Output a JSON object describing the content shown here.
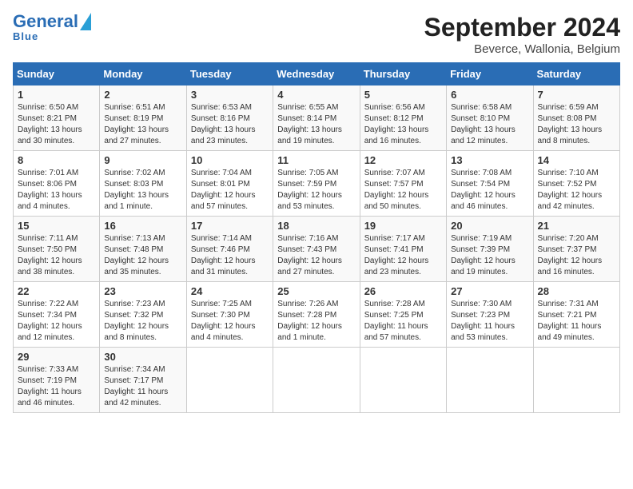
{
  "logo": {
    "general": "General",
    "blue": "Blue"
  },
  "title": "September 2024",
  "subtitle": "Beverce, Wallonia, Belgium",
  "weekdays": [
    "Sunday",
    "Monday",
    "Tuesday",
    "Wednesday",
    "Thursday",
    "Friday",
    "Saturday"
  ],
  "weeks": [
    [
      {
        "day": "1",
        "info": "Sunrise: 6:50 AM\nSunset: 8:21 PM\nDaylight: 13 hours\nand 30 minutes."
      },
      {
        "day": "2",
        "info": "Sunrise: 6:51 AM\nSunset: 8:19 PM\nDaylight: 13 hours\nand 27 minutes."
      },
      {
        "day": "3",
        "info": "Sunrise: 6:53 AM\nSunset: 8:16 PM\nDaylight: 13 hours\nand 23 minutes."
      },
      {
        "day": "4",
        "info": "Sunrise: 6:55 AM\nSunset: 8:14 PM\nDaylight: 13 hours\nand 19 minutes."
      },
      {
        "day": "5",
        "info": "Sunrise: 6:56 AM\nSunset: 8:12 PM\nDaylight: 13 hours\nand 16 minutes."
      },
      {
        "day": "6",
        "info": "Sunrise: 6:58 AM\nSunset: 8:10 PM\nDaylight: 13 hours\nand 12 minutes."
      },
      {
        "day": "7",
        "info": "Sunrise: 6:59 AM\nSunset: 8:08 PM\nDaylight: 13 hours\nand 8 minutes."
      }
    ],
    [
      {
        "day": "8",
        "info": "Sunrise: 7:01 AM\nSunset: 8:06 PM\nDaylight: 13 hours\nand 4 minutes."
      },
      {
        "day": "9",
        "info": "Sunrise: 7:02 AM\nSunset: 8:03 PM\nDaylight: 13 hours\nand 1 minute."
      },
      {
        "day": "10",
        "info": "Sunrise: 7:04 AM\nSunset: 8:01 PM\nDaylight: 12 hours\nand 57 minutes."
      },
      {
        "day": "11",
        "info": "Sunrise: 7:05 AM\nSunset: 7:59 PM\nDaylight: 12 hours\nand 53 minutes."
      },
      {
        "day": "12",
        "info": "Sunrise: 7:07 AM\nSunset: 7:57 PM\nDaylight: 12 hours\nand 50 minutes."
      },
      {
        "day": "13",
        "info": "Sunrise: 7:08 AM\nSunset: 7:54 PM\nDaylight: 12 hours\nand 46 minutes."
      },
      {
        "day": "14",
        "info": "Sunrise: 7:10 AM\nSunset: 7:52 PM\nDaylight: 12 hours\nand 42 minutes."
      }
    ],
    [
      {
        "day": "15",
        "info": "Sunrise: 7:11 AM\nSunset: 7:50 PM\nDaylight: 12 hours\nand 38 minutes."
      },
      {
        "day": "16",
        "info": "Sunrise: 7:13 AM\nSunset: 7:48 PM\nDaylight: 12 hours\nand 35 minutes."
      },
      {
        "day": "17",
        "info": "Sunrise: 7:14 AM\nSunset: 7:46 PM\nDaylight: 12 hours\nand 31 minutes."
      },
      {
        "day": "18",
        "info": "Sunrise: 7:16 AM\nSunset: 7:43 PM\nDaylight: 12 hours\nand 27 minutes."
      },
      {
        "day": "19",
        "info": "Sunrise: 7:17 AM\nSunset: 7:41 PM\nDaylight: 12 hours\nand 23 minutes."
      },
      {
        "day": "20",
        "info": "Sunrise: 7:19 AM\nSunset: 7:39 PM\nDaylight: 12 hours\nand 19 minutes."
      },
      {
        "day": "21",
        "info": "Sunrise: 7:20 AM\nSunset: 7:37 PM\nDaylight: 12 hours\nand 16 minutes."
      }
    ],
    [
      {
        "day": "22",
        "info": "Sunrise: 7:22 AM\nSunset: 7:34 PM\nDaylight: 12 hours\nand 12 minutes."
      },
      {
        "day": "23",
        "info": "Sunrise: 7:23 AM\nSunset: 7:32 PM\nDaylight: 12 hours\nand 8 minutes."
      },
      {
        "day": "24",
        "info": "Sunrise: 7:25 AM\nSunset: 7:30 PM\nDaylight: 12 hours\nand 4 minutes."
      },
      {
        "day": "25",
        "info": "Sunrise: 7:26 AM\nSunset: 7:28 PM\nDaylight: 12 hours\nand 1 minute."
      },
      {
        "day": "26",
        "info": "Sunrise: 7:28 AM\nSunset: 7:25 PM\nDaylight: 11 hours\nand 57 minutes."
      },
      {
        "day": "27",
        "info": "Sunrise: 7:30 AM\nSunset: 7:23 PM\nDaylight: 11 hours\nand 53 minutes."
      },
      {
        "day": "28",
        "info": "Sunrise: 7:31 AM\nSunset: 7:21 PM\nDaylight: 11 hours\nand 49 minutes."
      }
    ],
    [
      {
        "day": "29",
        "info": "Sunrise: 7:33 AM\nSunset: 7:19 PM\nDaylight: 11 hours\nand 46 minutes."
      },
      {
        "day": "30",
        "info": "Sunrise: 7:34 AM\nSunset: 7:17 PM\nDaylight: 11 hours\nand 42 minutes."
      },
      {
        "day": "",
        "info": ""
      },
      {
        "day": "",
        "info": ""
      },
      {
        "day": "",
        "info": ""
      },
      {
        "day": "",
        "info": ""
      },
      {
        "day": "",
        "info": ""
      }
    ]
  ]
}
